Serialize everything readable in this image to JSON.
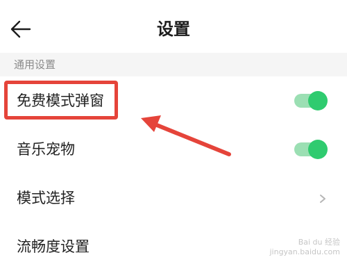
{
  "header": {
    "title": "设置",
    "back_icon": "back-arrow-icon"
  },
  "section": {
    "label": "通用设置"
  },
  "rows": [
    {
      "label": "免费模式弹窗",
      "control": "toggle",
      "on": true
    },
    {
      "label": "音乐宠物",
      "control": "toggle",
      "on": true
    },
    {
      "label": "模式选择",
      "control": "chevron"
    },
    {
      "label": "流畅度设置",
      "control": "none"
    }
  ],
  "colors": {
    "toggle_on": "#2fcb6f",
    "annotation": "#e5443a"
  },
  "watermark": {
    "line1": "Bai du 经验",
    "line2": "jingyan.baidu.com"
  }
}
